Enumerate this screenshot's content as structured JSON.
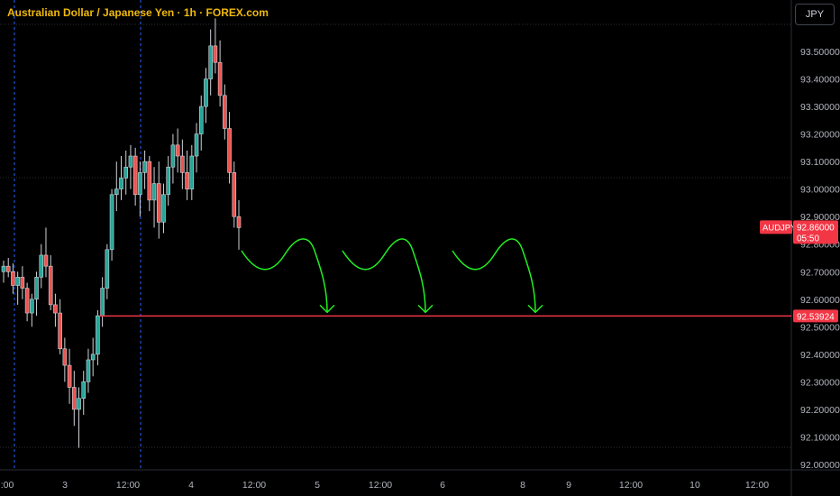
{
  "header": {
    "title": "Australian Dollar / Japanese Yen · 1h · FOREX.com",
    "currency_button": "JPY"
  },
  "colors": {
    "background": "#000000",
    "up_candle": "#26a69a",
    "down_candle": "#ef5350",
    "price_line": "#f23645",
    "arrow": "#22ee22",
    "session_line": "#2962ff",
    "badge": "#f23645"
  },
  "chart_data": {
    "type": "candlestick",
    "title": "Australian Dollar / Japanese Yen · 1h · FOREX.com",
    "symbol": "AUDJPY",
    "y_axis_ticks": [
      "93.50000",
      "93.40000",
      "93.30000",
      "93.20000",
      "93.10000",
      "93.00000",
      "92.90000",
      "92.80000",
      "92.70000",
      "92.60000",
      "92.50000",
      "92.40000",
      "92.30000",
      "92.20000",
      "92.10000",
      "92.00000"
    ],
    "x_axis_ticks": [
      ":00",
      "3",
      "12:00",
      "4",
      "12:00",
      "5",
      "12:00",
      "6",
      "8",
      "9",
      "12:00",
      "10",
      "12:00"
    ],
    "ylim": [
      91.98,
      93.66
    ],
    "current_price": {
      "symbol": "AUDJPY",
      "price": "92.86000",
      "countdown": "05:50"
    },
    "horizontal_line": {
      "price": 92.53924,
      "label": "92.53924"
    },
    "candles": [
      [
        92.7,
        92.74,
        92.66,
        92.72
      ],
      [
        92.72,
        92.75,
        92.68,
        92.7
      ],
      [
        92.7,
        92.73,
        92.62,
        92.65
      ],
      [
        92.65,
        92.7,
        92.58,
        92.68
      ],
      [
        92.68,
        92.72,
        92.6,
        92.64
      ],
      [
        92.64,
        92.66,
        92.52,
        92.55
      ],
      [
        92.55,
        92.62,
        92.5,
        92.6
      ],
      [
        92.6,
        92.7,
        92.54,
        92.68
      ],
      [
        92.68,
        92.8,
        92.64,
        92.76
      ],
      [
        92.76,
        92.86,
        92.68,
        92.72
      ],
      [
        92.72,
        92.76,
        92.56,
        92.58
      ],
      [
        92.58,
        92.62,
        92.5,
        92.55
      ],
      [
        92.55,
        92.6,
        92.4,
        92.42
      ],
      [
        92.42,
        92.46,
        92.3,
        92.36
      ],
      [
        92.36,
        92.42,
        92.22,
        92.28
      ],
      [
        92.28,
        92.34,
        92.14,
        92.2
      ],
      [
        92.2,
        92.28,
        92.06,
        92.24
      ],
      [
        92.24,
        92.34,
        92.18,
        92.3
      ],
      [
        92.3,
        92.42,
        92.26,
        92.38
      ],
      [
        92.38,
        92.46,
        92.32,
        92.4
      ],
      [
        92.4,
        92.56,
        92.36,
        92.54
      ],
      [
        92.54,
        92.68,
        92.5,
        92.64
      ],
      [
        92.64,
        92.8,
        92.6,
        92.78
      ],
      [
        92.78,
        93.0,
        92.74,
        92.98
      ],
      [
        92.98,
        93.1,
        92.92,
        93.0
      ],
      [
        93.0,
        93.12,
        92.96,
        93.04
      ],
      [
        93.04,
        93.14,
        92.98,
        93.08
      ],
      [
        93.08,
        93.16,
        93.0,
        93.12
      ],
      [
        93.12,
        93.15,
        92.94,
        92.98
      ],
      [
        92.98,
        93.1,
        92.9,
        93.06
      ],
      [
        93.06,
        93.14,
        93.0,
        93.1
      ],
      [
        93.1,
        93.12,
        92.92,
        92.96
      ],
      [
        92.96,
        93.08,
        92.86,
        93.02
      ],
      [
        93.02,
        93.1,
        92.82,
        92.88
      ],
      [
        92.88,
        93.02,
        92.84,
        92.98
      ],
      [
        92.98,
        93.12,
        92.94,
        93.08
      ],
      [
        93.08,
        93.2,
        93.02,
        93.16
      ],
      [
        93.16,
        93.22,
        93.06,
        93.12
      ],
      [
        93.12,
        93.18,
        93.0,
        93.06
      ],
      [
        93.06,
        93.14,
        92.96,
        93.0
      ],
      [
        93.0,
        93.16,
        92.96,
        93.12
      ],
      [
        93.12,
        93.24,
        93.06,
        93.2
      ],
      [
        93.2,
        93.34,
        93.14,
        93.3
      ],
      [
        93.3,
        93.44,
        93.24,
        93.4
      ],
      [
        93.4,
        93.58,
        93.34,
        93.52
      ],
      [
        93.52,
        93.62,
        93.42,
        93.46
      ],
      [
        93.46,
        93.54,
        93.3,
        93.34
      ],
      [
        93.34,
        93.38,
        93.18,
        93.22
      ],
      [
        93.22,
        93.28,
        93.02,
        93.06
      ],
      [
        93.06,
        93.1,
        92.86,
        92.9
      ],
      [
        92.9,
        92.96,
        92.78,
        92.86
      ]
    ]
  }
}
